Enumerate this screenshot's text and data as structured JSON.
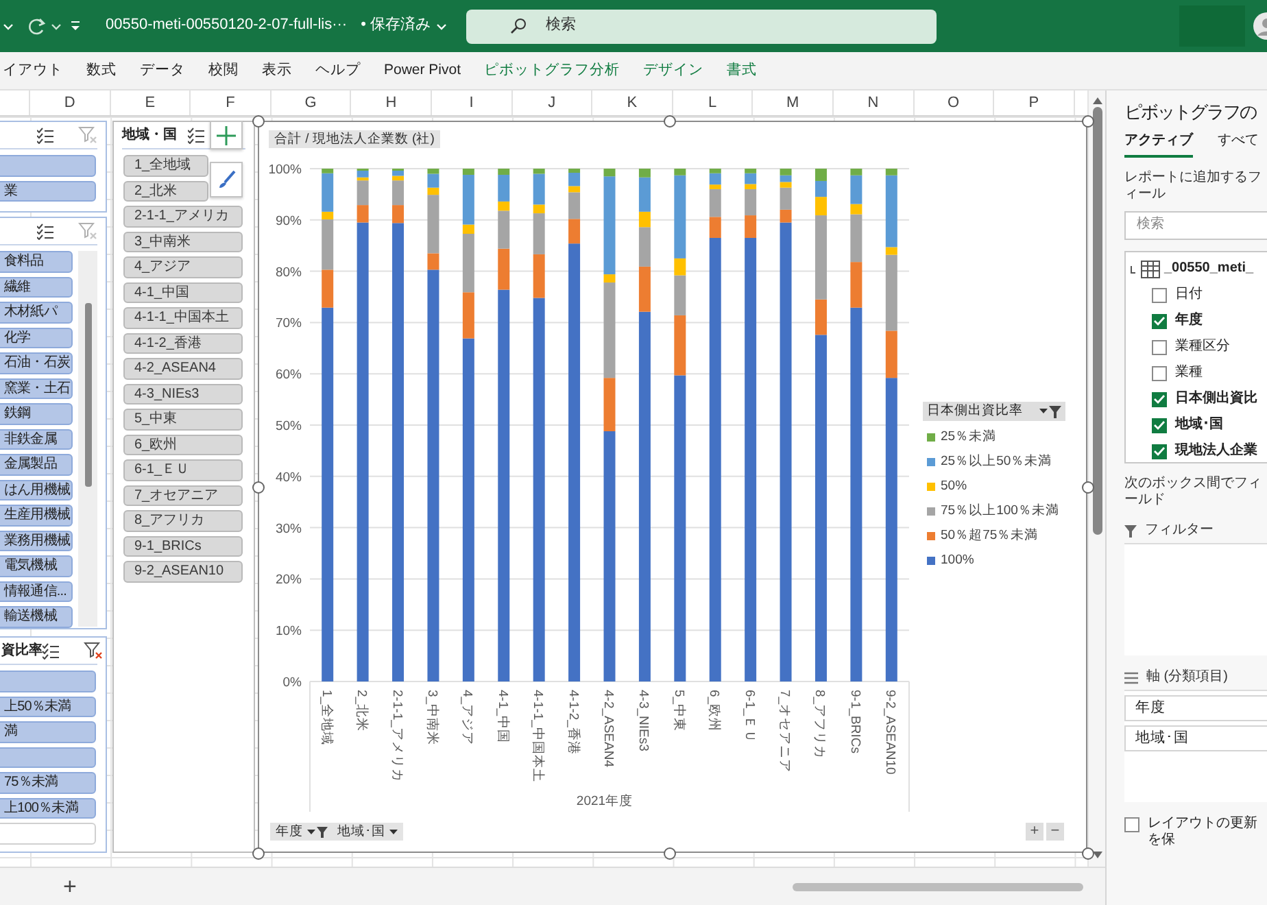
{
  "title_bar": {
    "filename": "00550-meti-00550120-2-07-full-lis···",
    "save_status": "• 保存済み",
    "search": {
      "placeholder": "検索"
    }
  },
  "ribbon_tabs": [
    {
      "label": "イアウト",
      "contextual": false
    },
    {
      "label": "数式",
      "contextual": false
    },
    {
      "label": "データ",
      "contextual": false
    },
    {
      "label": "校閲",
      "contextual": false
    },
    {
      "label": "表示",
      "contextual": false
    },
    {
      "label": "ヘルプ",
      "contextual": false
    },
    {
      "label": "Power Pivot",
      "contextual": false
    },
    {
      "label": "ピボットグラフ分析",
      "contextual": true
    },
    {
      "label": "デザイン",
      "contextual": true
    },
    {
      "label": "書式",
      "contextual": true
    }
  ],
  "columns": [
    "D",
    "E",
    "F",
    "G",
    "H",
    "I",
    "J",
    "K",
    "L",
    "M",
    "N",
    "O",
    "P"
  ],
  "slicers": [
    {
      "color": "#b4c6e7",
      "filtered": false,
      "scrollable": false,
      "items": [
        {
          "selected": true
        },
        {
          "label": "業",
          "selected": true
        }
      ]
    },
    {
      "color": "#b4c6e7",
      "filtered": false,
      "scrollable": true,
      "items": [
        {
          "label": "食料品",
          "selected": true
        },
        {
          "label": "繊維",
          "selected": true
        },
        {
          "label": "木材紙パ",
          "selected": true
        },
        {
          "label": "化学",
          "selected": true
        },
        {
          "label": "石油・石炭",
          "selected": true
        },
        {
          "label": "窯業・土石",
          "selected": true
        },
        {
          "label": "鉄鋼",
          "selected": true
        },
        {
          "label": "非鉄金属",
          "selected": true
        },
        {
          "label": "金属製品",
          "selected": true
        },
        {
          "label": "はん用機械",
          "selected": true
        },
        {
          "label": "生産用機械",
          "selected": true
        },
        {
          "label": "業務用機械",
          "selected": true
        },
        {
          "label": "電気機械",
          "selected": true
        },
        {
          "label": "情報通信...",
          "selected": true
        },
        {
          "label": "輸送機械",
          "selected": true
        }
      ]
    },
    {
      "title": "資比率",
      "color": "#b4c6e7",
      "filtered": true,
      "scrollable": false,
      "items": [
        {
          "selected": true
        },
        {
          "label": "上50％未満",
          "selected": true
        },
        {
          "label": "満",
          "selected": true
        },
        {
          "selected": true
        },
        {
          "label": "75％未満",
          "selected": true
        },
        {
          "label": "上100％未満",
          "selected": true
        },
        {
          "selected": false
        }
      ]
    },
    {
      "title": "地域・国",
      "color": "#d9d9d9",
      "scrollable": false,
      "items": [
        {
          "label": "1_全地域",
          "selected": true
        },
        {
          "label": "2_北米",
          "selected": true
        },
        {
          "label": "2-1-1_アメリカ",
          "selected": true
        },
        {
          "label": "3_中南米",
          "selected": true
        },
        {
          "label": "4_アジア",
          "selected": true
        },
        {
          "label": "4-1_中国",
          "selected": true
        },
        {
          "label": "4-1-1_中国本土",
          "selected": true
        },
        {
          "label": "4-1-2_香港",
          "selected": true
        },
        {
          "label": "4-2_ASEAN4",
          "selected": true
        },
        {
          "label": "4-3_NIEs3",
          "selected": true
        },
        {
          "label": "5_中東",
          "selected": true
        },
        {
          "label": "6_欧州",
          "selected": true
        },
        {
          "label": "6-1_ＥＵ",
          "selected": true
        },
        {
          "label": "7_オセアニア",
          "selected": true
        },
        {
          "label": "8_アフリカ",
          "selected": true
        },
        {
          "label": "9-1_BRICs",
          "selected": true
        },
        {
          "label": "9-2_ASEAN10",
          "selected": true
        }
      ]
    }
  ],
  "chart": {
    "value_button": "合計 / 現地法人企業数 (社)",
    "legend_title": "日本側出資比率",
    "field_buttons": [
      {
        "label": "年度",
        "filtered": true
      },
      {
        "label": "地域･国",
        "filtered": false
      }
    ],
    "zoom_buttons": [
      "+",
      "−"
    ],
    "chart_data": {
      "type": "bar",
      "stacked": true,
      "grid": true,
      "legend": true,
      "xlabel": "2021年度",
      "categories": [
        "1_全地域",
        "2_北米",
        "2-1-1_アメリカ",
        "3_中南米",
        "4_アジア",
        "4-1_中国",
        "4-1-1_中国本土",
        "4-1-2_香港",
        "4-2_ASEAN4",
        "4-3_NIEs3",
        "5_中東",
        "6_欧州",
        "6-1_ＥＵ",
        "7_オセアニア",
        "8_アフリカ",
        "9-1_BRICs",
        "9-2_ASEAN10"
      ],
      "ylim": [
        0,
        100
      ],
      "yticks": [
        {
          "value": 0,
          "label": "0%"
        },
        {
          "value": 10,
          "label": "10%"
        },
        {
          "value": 20,
          "label": "20%"
        },
        {
          "value": 30,
          "label": "30%"
        },
        {
          "value": 40,
          "label": "40%"
        },
        {
          "value": 50,
          "label": "50%"
        },
        {
          "value": 60,
          "label": "60%"
        },
        {
          "value": 70,
          "label": "70%"
        },
        {
          "value": 80,
          "label": "80%"
        },
        {
          "value": 90,
          "label": "90%"
        },
        {
          "value": 100,
          "label": "100%"
        }
      ],
      "series": [
        {
          "name": "100%",
          "color": "#4472c4",
          "values": [
            72.9,
            89.5,
            89.4,
            80.3,
            66.9,
            76.4,
            74.8,
            85.4,
            48.8,
            72.1,
            59.7,
            86.5,
            86.5,
            89.5,
            67.6,
            72.9,
            59.2
          ]
        },
        {
          "name": "50％超75％未満",
          "color": "#ed7d31",
          "values": [
            7.4,
            3.4,
            3.5,
            3.2,
            9.0,
            8.0,
            8.5,
            4.8,
            10.4,
            8.8,
            11.7,
            4.1,
            4.4,
            2.5,
            6.9,
            8.9,
            9.2
          ]
        },
        {
          "name": "75％以上100％未満",
          "color": "#a5a5a5",
          "values": [
            9.8,
            4.8,
            4.8,
            11.4,
            11.4,
            7.4,
            8.0,
            5.2,
            18.6,
            7.7,
            7.8,
            5.4,
            5.1,
            4.3,
            16.4,
            9.3,
            14.8
          ]
        },
        {
          "name": "50%",
          "color": "#ffc000",
          "values": [
            1.5,
            0.6,
            0.9,
            1.4,
            1.8,
            1.8,
            1.7,
            1.2,
            1.6,
            3.0,
            3.3,
            0.9,
            1.0,
            1.1,
            3.6,
            2.0,
            1.5
          ]
        },
        {
          "name": "25％以上50％未満",
          "color": "#5b9bd5",
          "values": [
            7.5,
            1.3,
            1.0,
            2.7,
            9.7,
            5.2,
            6.0,
            2.6,
            19.1,
            6.7,
            16.2,
            2.2,
            2.1,
            1.3,
            3.1,
            5.6,
            14.0
          ]
        },
        {
          "name": "25％未満",
          "color": "#70ad47",
          "values": [
            0.9,
            0.4,
            0.4,
            1.0,
            1.2,
            1.2,
            1.0,
            0.8,
            1.5,
            1.7,
            1.3,
            0.9,
            0.9,
            1.3,
            2.4,
            1.3,
            1.3
          ]
        }
      ]
    }
  },
  "field_pane": {
    "title": "ピボットグラフの",
    "tabs": [
      {
        "label": "アクティブ",
        "selected": true
      },
      {
        "label": "すべて",
        "selected": false
      }
    ],
    "hint": "レポートに追加するフィール",
    "search": {
      "placeholder": "検索"
    },
    "table_name": "_00550_meti_",
    "fields": [
      {
        "label": "日付",
        "checked": false
      },
      {
        "label": "年度",
        "checked": true
      },
      {
        "label": "業種区分",
        "checked": false
      },
      {
        "label": "業種",
        "checked": false
      },
      {
        "label": "日本側出資比",
        "checked": true
      },
      {
        "label": "地域･国",
        "checked": true
      },
      {
        "label": "現地法人企業",
        "checked": true
      }
    ],
    "drag_hint": "次のボックス間でフィールド",
    "areas": [
      {
        "kind": "filter",
        "label": "フィルター"
      },
      {
        "kind": "axis",
        "label": "軸 (分類項目)",
        "items": [
          "年度",
          "地域･国"
        ]
      }
    ],
    "defer": {
      "label": "レイアウトの更新を保",
      "checked": false
    }
  },
  "sheet_bar": {
    "add": "+"
  }
}
